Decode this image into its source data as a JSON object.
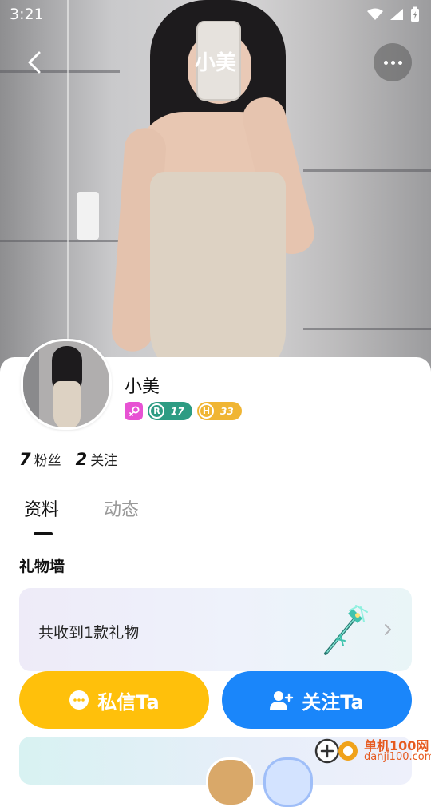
{
  "status_bar": {
    "time": "3:21"
  },
  "header": {
    "title": "小美"
  },
  "profile": {
    "name": "小美",
    "level_r": "17",
    "level_h": "33",
    "level_r_letter": "R",
    "level_h_letter": "H"
  },
  "stats": [
    {
      "value": "7",
      "label": "粉丝"
    },
    {
      "value": "2",
      "label": "关注"
    }
  ],
  "tabs": [
    {
      "label": "资料"
    },
    {
      "label": "动态"
    }
  ],
  "gift_wall": {
    "title": "礼物墙",
    "summary": "共收到1款礼物"
  },
  "actions": {
    "message_label": "私信Ta",
    "follow_label": "关注Ta"
  },
  "watermark": {
    "line1": "单机100网",
    "line2": "danji100.com"
  },
  "colors": {
    "message_button": "#ffc00b",
    "follow_button": "#1a86fa",
    "gender_badge": "#e752d3",
    "level_r_badge": "#2d9c83",
    "level_h_badge": "#f0b533"
  },
  "icons": [
    "back-arrow-icon",
    "more-icon",
    "female-icon",
    "chevron-right-icon",
    "chat-bubble-icon",
    "add-user-icon",
    "wifi-icon",
    "signal-icon",
    "battery-icon",
    "wand-gift-icon"
  ]
}
